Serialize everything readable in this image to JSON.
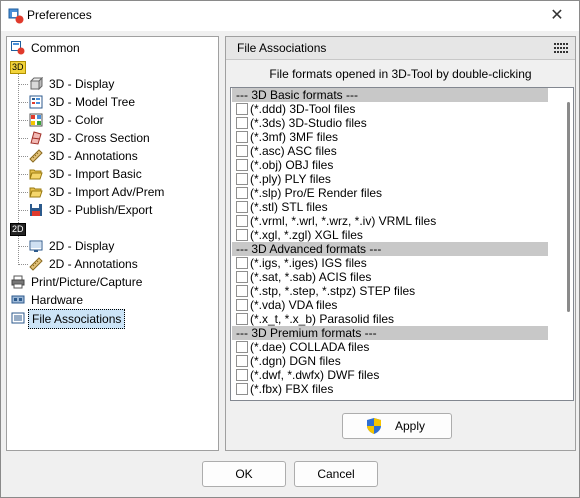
{
  "window": {
    "title": "Preferences",
    "close_glyph": "✕"
  },
  "tree": {
    "common": "Common",
    "group3d": "3D",
    "group2d": "2D",
    "items3d": [
      {
        "label": "3D - Display",
        "icon": "cube-icon"
      },
      {
        "label": "3D - Model Tree",
        "icon": "model-tree-icon"
      },
      {
        "label": "3D - Color",
        "icon": "color-grid-icon"
      },
      {
        "label": "3D - Cross Section",
        "icon": "cross-section-icon"
      },
      {
        "label": "3D - Annotations",
        "icon": "ruler-icon"
      },
      {
        "label": "3D - Import Basic",
        "icon": "folder-open-icon"
      },
      {
        "label": "3D - Import Adv/Prem",
        "icon": "folder-open-icon"
      },
      {
        "label": "3D - Publish/Export",
        "icon": "floppy-disk-icon"
      }
    ],
    "items2d": [
      {
        "label": "2D - Display",
        "icon": "display-icon"
      },
      {
        "label": "2D - Annotations",
        "icon": "ruler-icon"
      }
    ],
    "print": "Print/Picture/Capture",
    "hardware": "Hardware",
    "fileassoc": "File Associations"
  },
  "panel": {
    "header": "File Associations",
    "caption": "File formats opened in 3D-Tool by double-clicking",
    "groups": [
      {
        "title": "--- 3D Basic formats ---",
        "items": [
          "(*.ddd) 3D-Tool files",
          "(*.3ds) 3D-Studio files",
          "(*.3mf) 3MF files",
          "(*.asc) ASC files",
          "(*.obj) OBJ files",
          "(*.ply) PLY files",
          "(*.slp) Pro/E Render files",
          "(*.stl) STL files",
          "(*.vrml, *.wrl, *.wrz, *.iv) VRML files",
          "(*.xgl, *.zgl) XGL files"
        ]
      },
      {
        "title": "--- 3D Advanced formats ---",
        "items": [
          "(*.igs, *.iges) IGS files",
          "(*.sat, *.sab) ACIS files",
          "(*.stp, *.step, *.stpz) STEP files",
          "(*.vda) VDA files",
          "(*.x_t, *.x_b) Parasolid files"
        ]
      },
      {
        "title": "--- 3D Premium formats ---",
        "items": [
          "(*.dae) COLLADA files",
          "(*.dgn) DGN files",
          "(*.dwf, *.dwfx) DWF files",
          "(*.fbx) FBX files"
        ]
      }
    ],
    "apply_label": "Apply"
  },
  "footer": {
    "ok_label": "OK",
    "cancel_label": "Cancel"
  },
  "colors": {
    "selection": "#cce4f7",
    "group_header": "#c8c8c8",
    "accent_red": "#e03a2c"
  }
}
